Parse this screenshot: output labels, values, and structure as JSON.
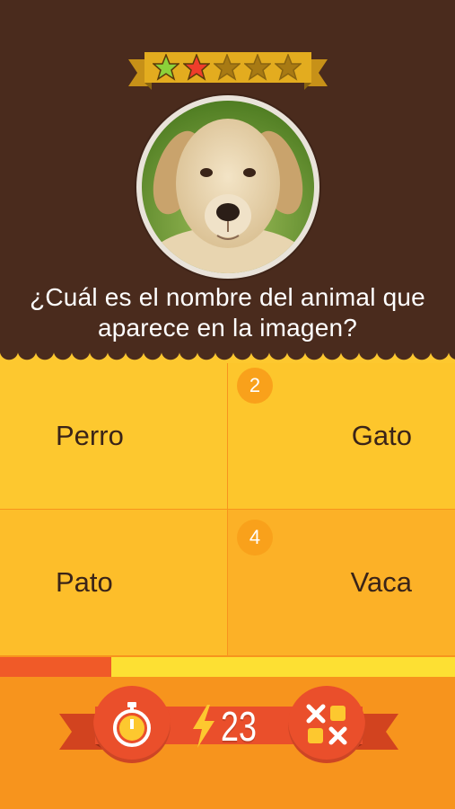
{
  "level": {
    "stars_total": 5,
    "stars_filled": 2
  },
  "question": {
    "text": "¿Cuál es el nombre del animal que aparece en la imagen?"
  },
  "answers": [
    {
      "label": "Perro"
    },
    {
      "label": "Gato"
    },
    {
      "label": "Pato"
    },
    {
      "label": "Vaca"
    }
  ],
  "badges": [
    "2",
    "4"
  ],
  "progress": {
    "fraction": 0.245
  },
  "energy": {
    "count": "23"
  },
  "icons": {
    "timer": "stopwatch-icon",
    "energy": "lightning-bolt-icon",
    "eliminate": "remove-answers-icon"
  },
  "colors": {
    "top_panel": "#4a2b1d",
    "answer_yellow": "#fdc82f",
    "accent_orange": "#f7941d",
    "accent_red": "#ea4f2b",
    "progress": "#f05a28"
  }
}
